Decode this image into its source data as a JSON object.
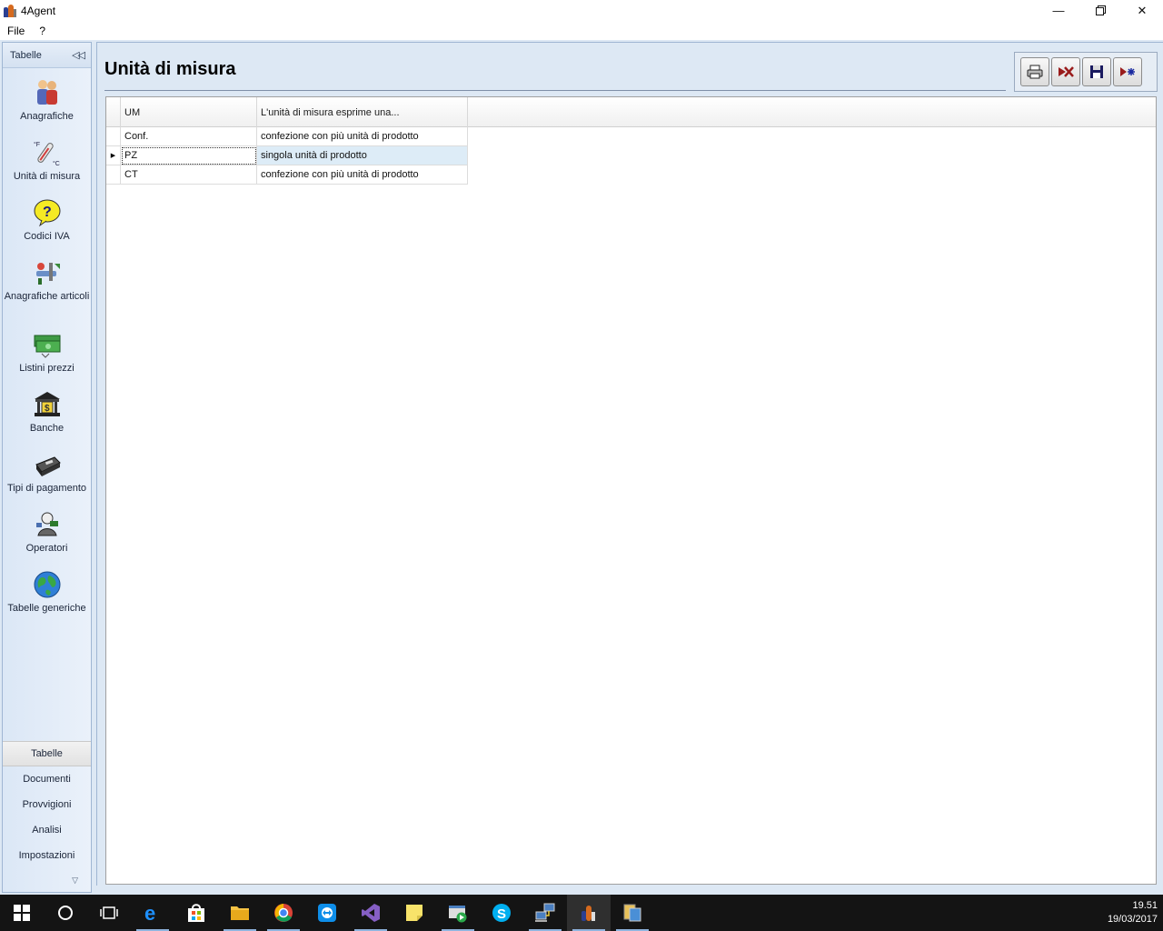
{
  "window": {
    "title": "4Agent"
  },
  "menu": {
    "items": [
      "File",
      "?"
    ]
  },
  "sidebar": {
    "header": "Tabelle",
    "items": [
      {
        "label": "Anagrafiche",
        "icon": "people-icon"
      },
      {
        "label": "Unità di misura",
        "icon": "thermometer-icon"
      },
      {
        "label": "Codici IVA",
        "icon": "question-bubble-icon"
      },
      {
        "label": "Anagrafiche articoli",
        "icon": "tools-icon"
      },
      {
        "label": "Listini prezzi",
        "icon": "banknotes-icon"
      },
      {
        "label": "Banche",
        "icon": "bank-icon"
      },
      {
        "label": "Tipi di pagamento",
        "icon": "cash-register-icon"
      },
      {
        "label": "Operatori",
        "icon": "operator-icon"
      },
      {
        "label": "Tabelle generiche",
        "icon": "globe-icon"
      }
    ],
    "nav": [
      {
        "label": "Tabelle",
        "active": true
      },
      {
        "label": "Documenti"
      },
      {
        "label": "Provvigioni"
      },
      {
        "label": "Analisi"
      },
      {
        "label": "Impostazioni"
      }
    ]
  },
  "main": {
    "title": "Unità di misura",
    "toolbar": [
      "print-icon",
      "delete-icon",
      "save-icon",
      "new-record-icon"
    ]
  },
  "grid": {
    "columns": [
      "UM",
      "L'unità di misura esprime una..."
    ],
    "rows": [
      [
        "Conf.",
        "confezione con più unità di prodotto"
      ],
      [
        "PZ",
        "singola unità di prodotto"
      ],
      [
        "CT",
        "confezione con più unità di prodotto"
      ]
    ],
    "selected_row": 1
  },
  "taskbar": {
    "time": "19.51",
    "date": "19/03/2017"
  },
  "colors": {
    "accent": "#dde8f4",
    "selection": "#ddecf7",
    "taskbar": "#141414"
  }
}
